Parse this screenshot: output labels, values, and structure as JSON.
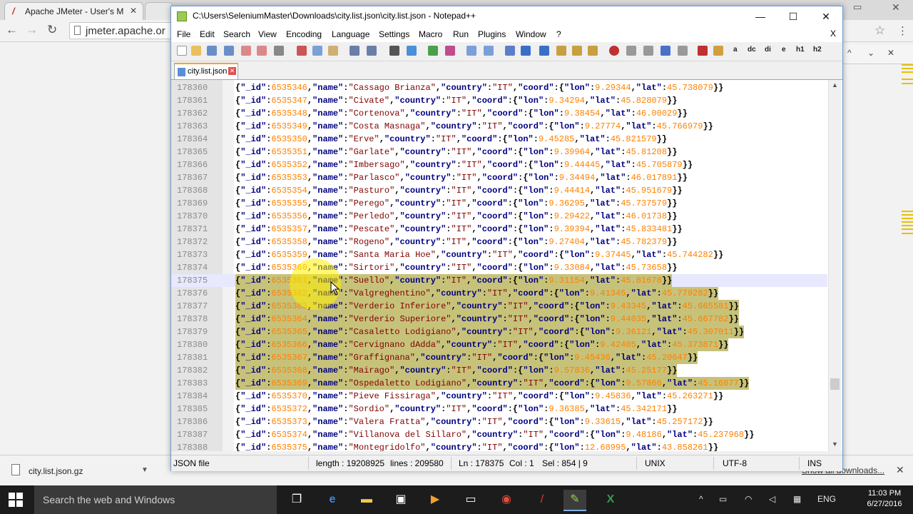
{
  "browser": {
    "tab_title": "Apache JMeter - User's M",
    "tab_close": "✕",
    "url": "jmeter.apache.or",
    "back": "←",
    "forward": "→",
    "reload": "↻",
    "star": "☆",
    "menu": "⋮",
    "find_up": "^",
    "find_down": "⌄",
    "find_close": "✕"
  },
  "downloads": {
    "file_name": "city.list.json.gz",
    "show_all": "Show all downloads...",
    "close": "✕",
    "arrow": "▼"
  },
  "taskbar": {
    "search_placeholder": "Search the web and Windows",
    "language": "ENG",
    "time": "11:03 PM",
    "date": "6/27/2016"
  },
  "npp": {
    "title": "C:\\Users\\SeleniumMaster\\Downloads\\city.list.json\\city.list.json - Notepad++",
    "menu": [
      "File",
      "Edit",
      "Search",
      "View",
      "Encoding",
      "Language",
      "Settings",
      "Macro",
      "Run",
      "Plugins",
      "Window",
      "?"
    ],
    "menu_close": "X",
    "toolbar_text": [
      "a",
      "dc",
      "di",
      "e",
      "h1",
      "h2"
    ],
    "tab_label": "city.list.json",
    "tab_close": "✕",
    "status": {
      "type": "JSON file",
      "length": "length : 19208925",
      "lines": "lines : 209580",
      "ln": "Ln : 178375",
      "col": "Col : 1",
      "sel": "Sel : 854 | 9",
      "eol": "UNIX",
      "enc": "UTF-8",
      "ins": "INS"
    }
  },
  "editor": {
    "lines": [
      {
        "ln": "178360",
        "id": "6535346",
        "name": "Cassago Brianza",
        "lon": "9.29344",
        "lat": "45.738079"
      },
      {
        "ln": "178361",
        "id": "6535347",
        "name": "Civate",
        "lon": "9.34294",
        "lat": "45.828079"
      },
      {
        "ln": "178362",
        "id": "6535348",
        "name": "Cortenova",
        "lon": "9.38454",
        "lat": "46.00029"
      },
      {
        "ln": "178363",
        "id": "6535349",
        "name": "Costa Masnaga",
        "lon": "9.27774",
        "lat": "45.766979"
      },
      {
        "ln": "178364",
        "id": "6535350",
        "name": "Erve",
        "lon": "9.45285",
        "lat": "45.821579"
      },
      {
        "ln": "178365",
        "id": "6535351",
        "name": "Garlate",
        "lon": "9.39964",
        "lat": "45.81208"
      },
      {
        "ln": "178366",
        "id": "6535352",
        "name": "Imbersago",
        "lon": "9.44445",
        "lat": "45.705879"
      },
      {
        "ln": "178367",
        "id": "6535353",
        "name": "Parlasco",
        "lon": "9.34494",
        "lat": "46.017891"
      },
      {
        "ln": "178368",
        "id": "6535354",
        "name": "Pasturo",
        "lon": "9.44414",
        "lat": "45.951679"
      },
      {
        "ln": "178369",
        "id": "6535355",
        "name": "Perego",
        "lon": "9.36295",
        "lat": "45.737579"
      },
      {
        "ln": "178370",
        "id": "6535356",
        "name": "Perledo",
        "lon": "9.29422",
        "lat": "46.01738"
      },
      {
        "ln": "178371",
        "id": "6535357",
        "name": "Pescate",
        "lon": "9.39394",
        "lat": "45.833481"
      },
      {
        "ln": "178372",
        "id": "6535358",
        "name": "Rogeno",
        "lon": "9.27404",
        "lat": "45.782379"
      },
      {
        "ln": "178373",
        "id": "6535359",
        "name": "Santa Maria Hoe",
        "lon": "9.37445",
        "lat": "45.744282"
      },
      {
        "ln": "178374",
        "id": "6535360",
        "name": "Sirtori",
        "lon": "9.33084",
        "lat": "45.73658"
      },
      {
        "ln": "178375",
        "id": "6535361",
        "name": "Suello",
        "lon": "9.31154",
        "lat": "45.81678"
      },
      {
        "ln": "178376",
        "id": "6535362",
        "name": "Valgreghentino",
        "lon": "9.41345",
        "lat": "45.779282"
      },
      {
        "ln": "178377",
        "id": "6535363",
        "name": "Verderio Inferiore",
        "lon": "9.43345",
        "lat": "45.665581"
      },
      {
        "ln": "178378",
        "id": "6535364",
        "name": "Verderio Superiore",
        "lon": "9.44035",
        "lat": "45.667782"
      },
      {
        "ln": "178379",
        "id": "6535365",
        "name": "Casaletto Lodigiano",
        "lon": "9.36121",
        "lat": "45.307011"
      },
      {
        "ln": "178380",
        "id": "6535366",
        "name": "Cervignano dAdda",
        "lon": "9.42405",
        "lat": "45.373871"
      },
      {
        "ln": "178381",
        "id": "6535367",
        "name": "Graffignana",
        "lon": "9.45436",
        "lat": "45.20647"
      },
      {
        "ln": "178382",
        "id": "6535368",
        "name": "Mairago",
        "lon": "9.57836",
        "lat": "45.25177"
      },
      {
        "ln": "178383",
        "id": "6535369",
        "name": "Ospedaletto Lodigiano",
        "lon": "9.57866",
        "lat": "45.16877"
      },
      {
        "ln": "178384",
        "id": "6535370",
        "name": "Pieve Fissiraga",
        "lon": "9.45836",
        "lat": "45.263271"
      },
      {
        "ln": "178385",
        "id": "6535372",
        "name": "Sordio",
        "lon": "9.36385",
        "lat": "45.342171"
      },
      {
        "ln": "178386",
        "id": "6535373",
        "name": "Valera Fratta",
        "lon": "9.33615",
        "lat": "45.257172"
      },
      {
        "ln": "178387",
        "id": "6535374",
        "name": "Villanova del Sillaro",
        "lon": "9.48186",
        "lat": "45.237968"
      },
      {
        "ln": "178388",
        "id": "6535375",
        "name": "Montegridolfo",
        "lon": "12.68995",
        "lat": "43.858261"
      }
    ],
    "country": "IT",
    "selection_start_line": "178375",
    "selection_end_line": "178383"
  },
  "colors": {
    "keyword": "#000080",
    "string": "#800000",
    "number": "#ff8000",
    "selection": "#c7c27a",
    "tab_accent": "#f5a623"
  },
  "icons": [
    "notepadpp-icon",
    "new-file-icon",
    "open-icon",
    "save-icon",
    "cut-icon",
    "copy-icon",
    "paste-icon",
    "undo-icon",
    "redo-icon",
    "find-icon",
    "zoom-icon",
    "record-macro-icon",
    "stop-macro-icon",
    "play-macro-icon",
    "spellcheck-icon"
  ]
}
